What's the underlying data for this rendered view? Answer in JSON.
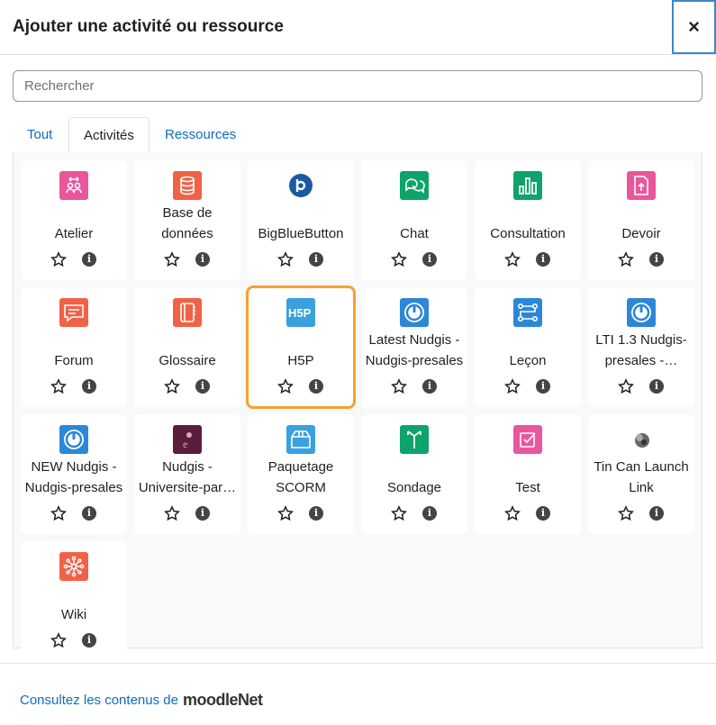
{
  "modal": {
    "title": "Ajouter une activité ou ressource",
    "close_symbol": "×"
  },
  "search": {
    "placeholder": "Rechercher"
  },
  "tabs": [
    {
      "label": "Tout",
      "active": false
    },
    {
      "label": "Activités",
      "active": true
    },
    {
      "label": "Ressources",
      "active": false
    }
  ],
  "activities": [
    {
      "name": "Atelier",
      "icon": "workshop-icon",
      "color": "#e8579b",
      "highlighted": false
    },
    {
      "name": "Base de données",
      "icon": "database-icon",
      "color": "#f06248",
      "highlighted": false
    },
    {
      "name": "BigBlueButton",
      "icon": "bigbluebutton-icon",
      "color": "#1b5aa3",
      "highlighted": false
    },
    {
      "name": "Chat",
      "icon": "chat-icon",
      "color": "#0ea36a",
      "highlighted": false
    },
    {
      "name": "Consultation",
      "icon": "consultation-icon",
      "color": "#0ea36a",
      "highlighted": false
    },
    {
      "name": "Devoir",
      "icon": "assignment-icon",
      "color": "#e8579b",
      "highlighted": false
    },
    {
      "name": "Forum",
      "icon": "forum-icon",
      "color": "#f06248",
      "highlighted": false
    },
    {
      "name": "Glossaire",
      "icon": "glossary-icon",
      "color": "#f06248",
      "highlighted": false
    },
    {
      "name": "H5P",
      "icon": "h5p-icon",
      "color": "#3aa0e0",
      "highlighted": true
    },
    {
      "name": "Latest Nudgis - Nudgis-presales",
      "icon": "nudgis-icon",
      "color": "#2c87d6",
      "highlighted": false
    },
    {
      "name": "Leçon",
      "icon": "lesson-icon",
      "color": "#2c87d6",
      "highlighted": false
    },
    {
      "name": "LTI 1.3 Nudgis-presales -…",
      "icon": "nudgis-icon",
      "color": "#2c87d6",
      "highlighted": false
    },
    {
      "name": "NEW Nudgis - Nudgis-presales",
      "icon": "nudgis-icon",
      "color": "#2c87d6",
      "highlighted": false
    },
    {
      "name": "Nudgis - Universite-par…",
      "icon": "nudgis-university-icon",
      "color": "#5a1e3c",
      "highlighted": false
    },
    {
      "name": "Paquetage SCORM",
      "icon": "scorm-package-icon",
      "color": "#3aa0e0",
      "highlighted": false
    },
    {
      "name": "Sondage",
      "icon": "survey-icon",
      "color": "#0ea36a",
      "highlighted": false
    },
    {
      "name": "Test",
      "icon": "quiz-icon",
      "color": "#e8579b",
      "highlighted": false
    },
    {
      "name": "Tin Can Launch Link",
      "icon": "tincan-icon",
      "color": "#555555",
      "highlighted": false
    },
    {
      "name": "Wiki",
      "icon": "wiki-icon",
      "color": "#f06248",
      "highlighted": false
    }
  ],
  "card_actions": {
    "info_symbol": "i"
  },
  "footer": {
    "link_text": "Consultez les contenus de",
    "logo_text": "moodleNet"
  }
}
